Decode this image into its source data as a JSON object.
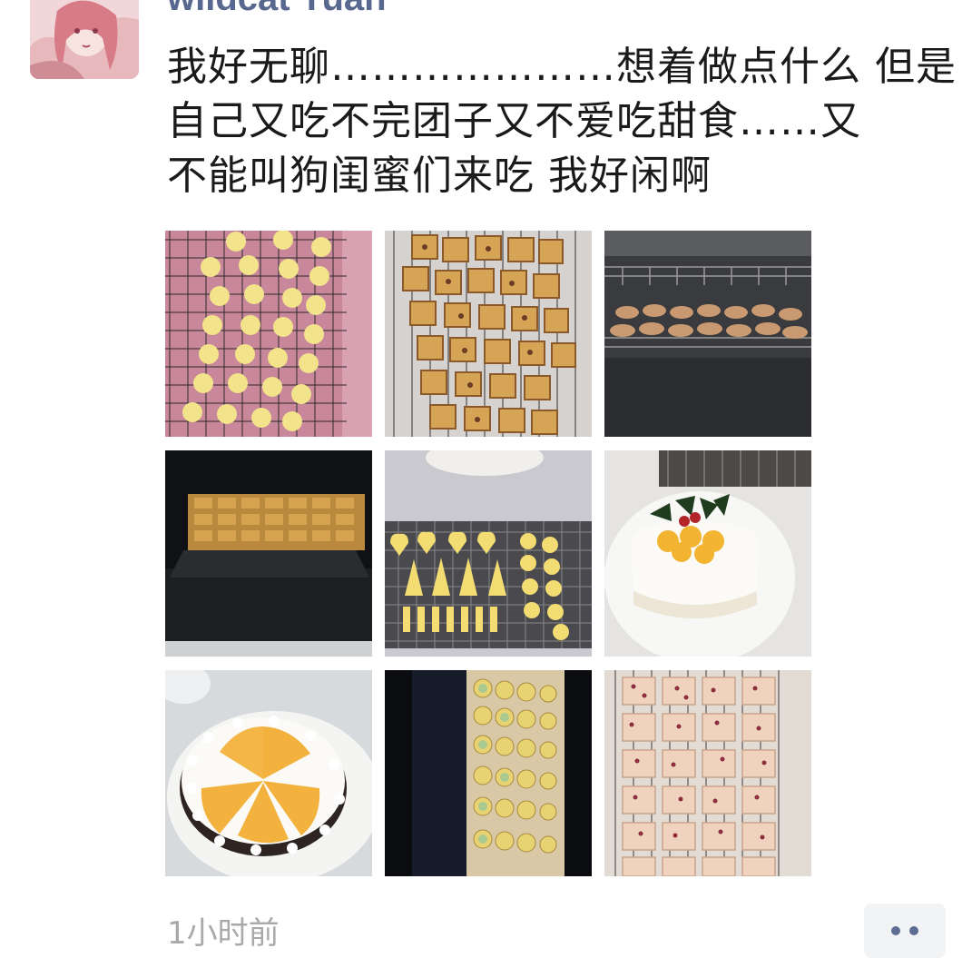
{
  "post": {
    "username": "wildcat Yuan",
    "text_lines": [
      "我好无聊…………………想着做点什么 但是",
      "自己又吃不完团子又不爱吃甜食……又",
      "不能叫狗闺蜜们来吃 我好闲啊"
    ],
    "timestamp": "1小时前"
  },
  "icons": {
    "avatar": "anime-girl-avatar",
    "more": "more-dots-icon"
  },
  "photos": [
    "flower-cookies-on-rack",
    "cranberry-squares-on-rack",
    "cookies-baking-in-oven",
    "tray-of-cookies-in-oven",
    "shaped-cookies-hearts-trees-bones",
    "mini-cream-cake-with-holly",
    "mango-cream-cake",
    "green-tea-cookies-in-oven",
    "cranberry-cookies-on-rack"
  ],
  "colors": {
    "username": "#58688f",
    "text": "#1a1a1a",
    "timestamp": "#a9a9a9",
    "more_bg": "#f2f3f5"
  }
}
